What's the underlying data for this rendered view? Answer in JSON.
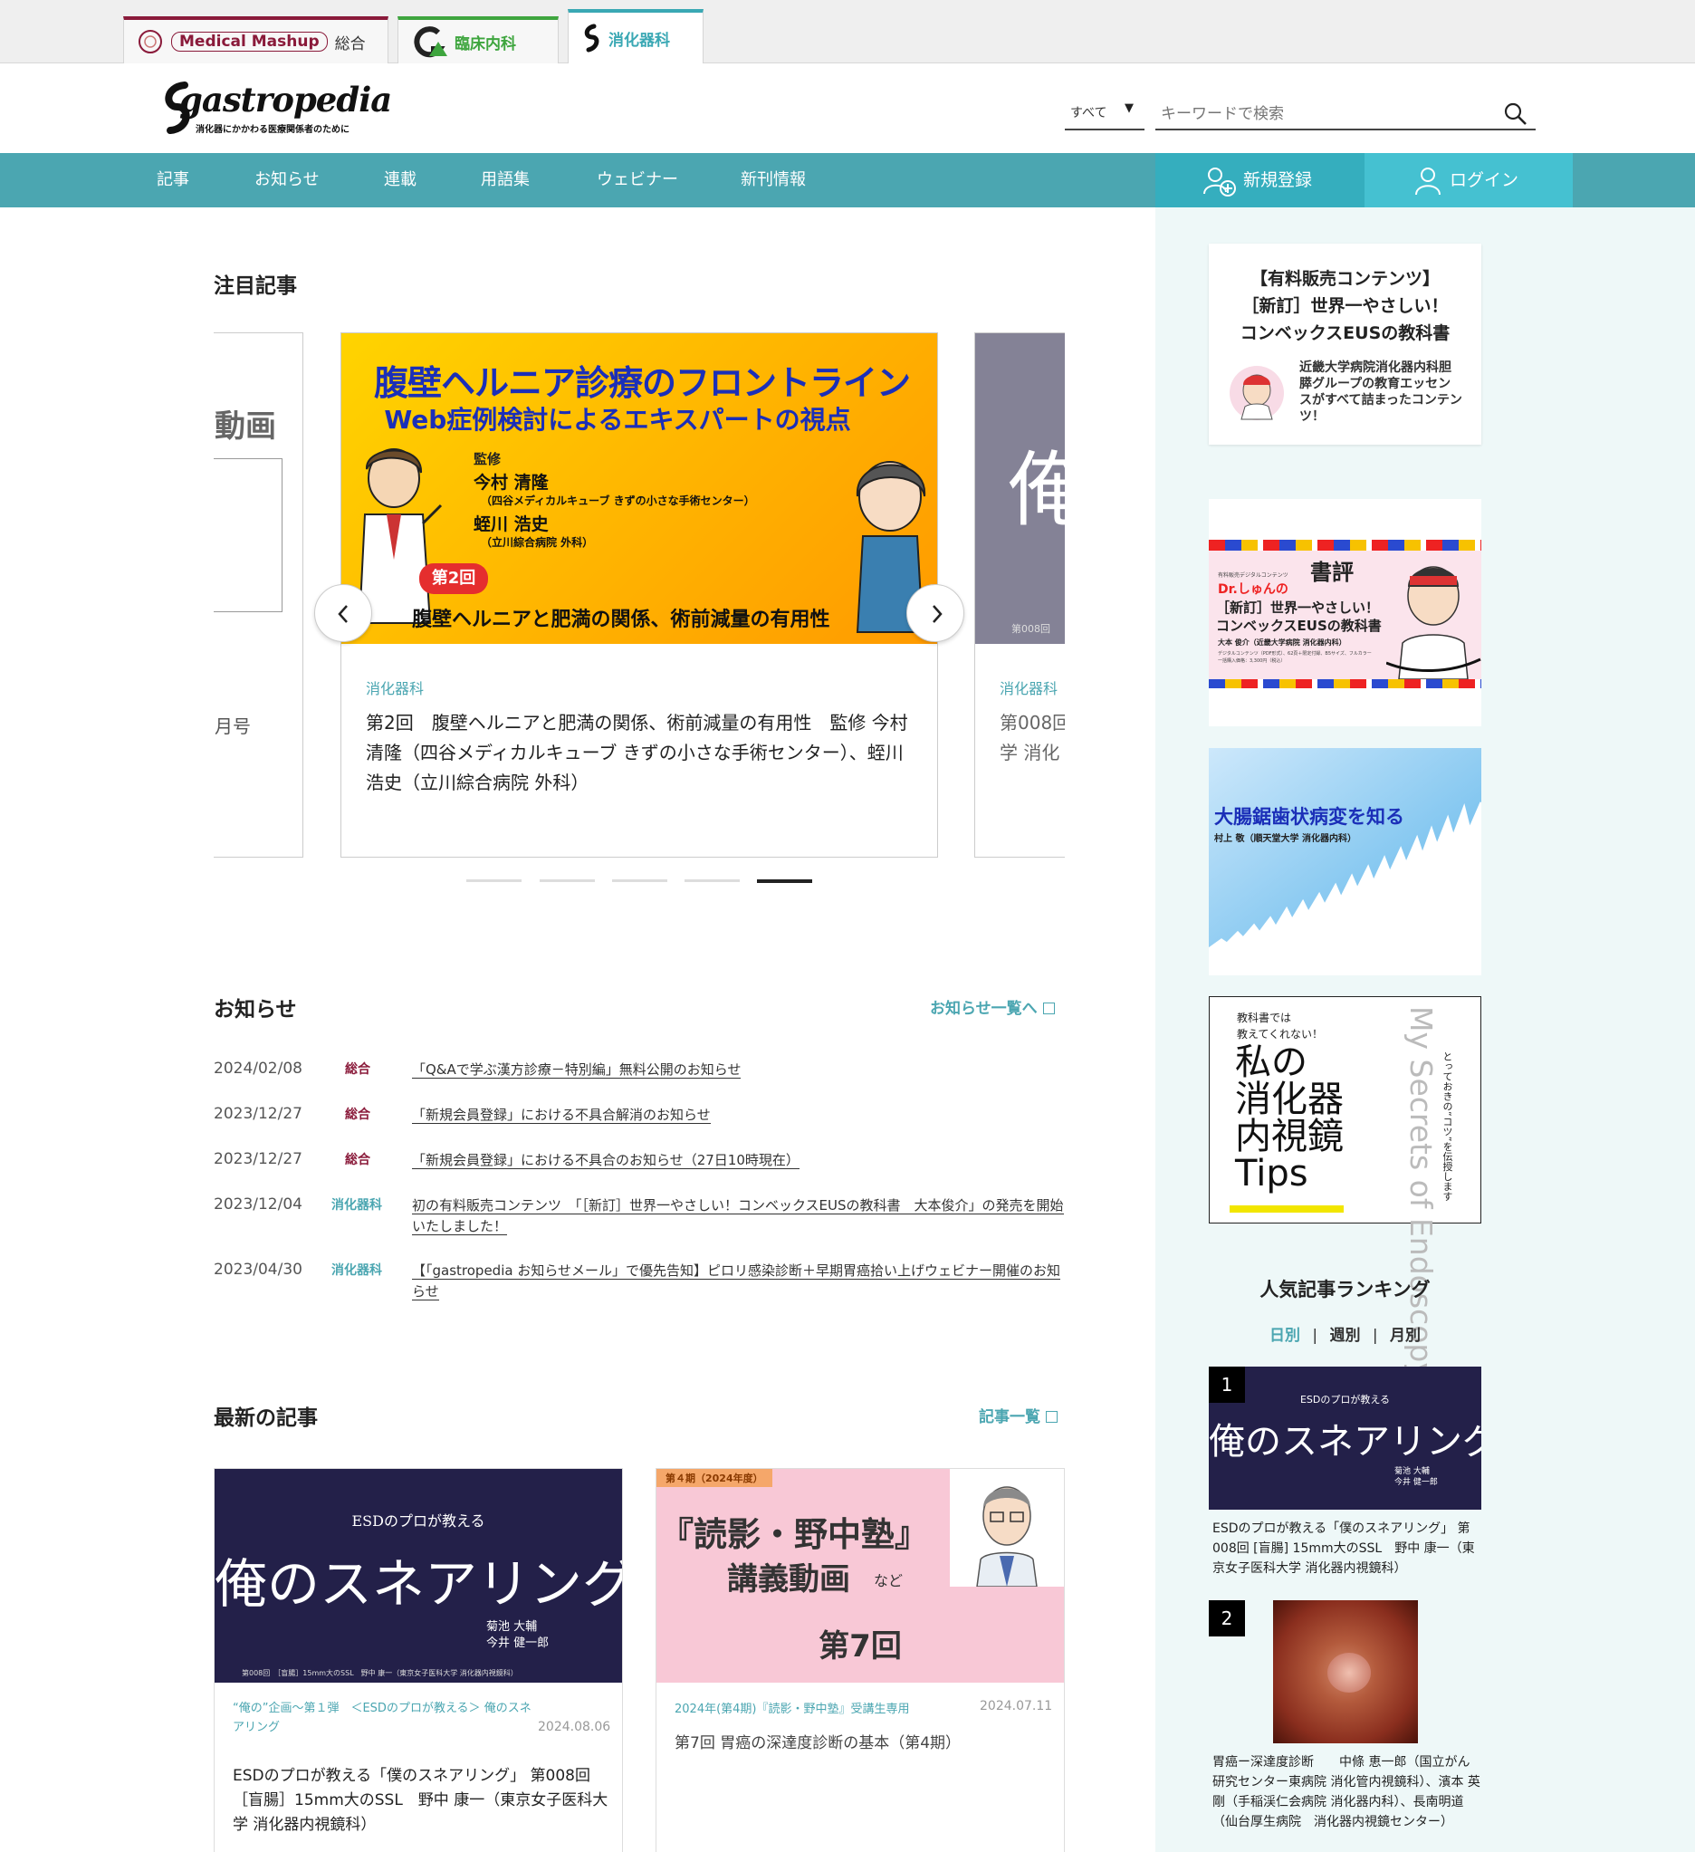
{
  "site_tabs": [
    {
      "name": "Medical Mashup",
      "label": "総合",
      "brand_color": "#8a1a3a"
    },
    {
      "name": "",
      "label": "臨床内科",
      "brand_color": "#3ea53e"
    },
    {
      "name": "",
      "label": "消化器科",
      "brand_color": "#3aa8b4"
    }
  ],
  "header": {
    "logo": "gastropedia",
    "tagline": "消化器にかかわる医療関係者のために",
    "search_scope": "すべて",
    "search_placeholder": "キーワードで検索"
  },
  "nav": {
    "items": [
      "記事",
      "お知らせ",
      "連載",
      "用語集",
      "ウェビナー",
      "新刊情報"
    ],
    "register": "新規登録",
    "login": "ログイン"
  },
  "featured": {
    "title": "注目記事",
    "left_peek": {
      "text": "動画",
      "date": "月号"
    },
    "main": {
      "banner_title": "腹壁ヘルニア診療のフロントライン",
      "banner_subtitle": "Web症例検討によるエキスパートの視点",
      "supervision_label": "監修",
      "person1": "今村 清隆",
      "person1_affil": "（四谷メディカルキューブ きずの小さな手術センター）",
      "person2": "蛭川 浩史",
      "person2_affil": "（立川綜合病院 外科）",
      "episode_badge": "第2回",
      "episode_title": "腹壁ヘルニアと肥満の関係、術前減量の有用性",
      "category": "消化器科",
      "text": "第2回　腹壁ヘルニアと肥満の関係、術前減量の有用性　監修 今村清隆（四谷メディカルキューブ きずの小さな手術センター）、蛭川浩史（立川綜合病院 外科）"
    },
    "right_peek": {
      "glyph": "俺",
      "episode": "第008回",
      "category": "消化器科",
      "line1": "第008回",
      "line2": "学 消化"
    },
    "slide_count": 5,
    "active_slide": 5
  },
  "news": {
    "title": "お知らせ",
    "more": "お知らせ一覧へ",
    "items": [
      {
        "date": "2024/02/08",
        "category": "総合",
        "text": "「Q&Aで学ぶ漢方診療－特別編」無料公開のお知らせ"
      },
      {
        "date": "2023/12/27",
        "category": "総合",
        "text": "「新規会員登録」における不具合解消のお知らせ"
      },
      {
        "date": "2023/12/27",
        "category": "総合",
        "text": "「新規会員登録」における不具合のお知らせ（27日10時現在）"
      },
      {
        "date": "2023/12/04",
        "category": "消化器科",
        "text": "初の有料販売コンテンツ　「［新訂］世界一やさしい！コンベックスEUSの教科書　大本俊介」の発売を開始いたしました！"
      },
      {
        "date": "2023/04/30",
        "category": "消化器科",
        "text": "【「gastropedia お知らせメール」で優先告知】ピロリ感染診断＋早期胃癌拾い上げウェビナー開催のお知らせ"
      }
    ]
  },
  "latest": {
    "title": "最新の記事",
    "more": "記事一覧",
    "articles": [
      {
        "image_small": "ESDのプロが教える",
        "image_title": "俺のスネアリング",
        "image_authors": "菊池 大輔\n今井 健一郎",
        "image_footer": "第008回　［盲腸］15mm大のSSL　野中 康一（東京女子医科大学 消化器内視鏡科）",
        "series": "“俺の”企画〜第１弾　＜ESDのプロが教える＞ 俺のスネアリング",
        "date": "2024.08.06",
        "title": "ESDのプロが教える「僕のスネアリング」 第008回［盲腸］15mm大のSSL　野中 康一（東京女子医科大学 消化器内視鏡科）"
      },
      {
        "image_tag": "第４期（2024年度）",
        "image_title": "『読影・野中塾』",
        "image_sub": "講義動画",
        "image_nado": "など",
        "image_episode": "第7回",
        "series": "2024年(第4期)『読影・野中塾』受講生専用",
        "date": "2024.07.11",
        "title": "第7回 胃癌の深達度診断の基本（第4期）"
      }
    ]
  },
  "sidebar": {
    "promo": {
      "line1": "【有料販売コンテンツ】",
      "line2": "［新訂］世界一やさしい！",
      "line3": "コンベックスEUSの教科書",
      "desc": "近畿大学病院消化器内科胆膵グループの教育エッセンスがすべて詰まったコンテンツ！"
    },
    "banner_review": {
      "badge": "書評",
      "small": "有料販売デジタルコンテンツ",
      "brand": "Dr.しゅんの",
      "title1": "［新訂］世界一やさしい！",
      "title2": "コンベックスEUSの教科書",
      "author": "大本 俊介（近畿大学病院 消化器内科）",
      "note1": "デジタルコンテンツ（PDF形式）、62頁＋限定付録、B5サイズ、フルカラー",
      "note2": "一括購入価格：3,300円（税込）"
    },
    "banner_serrated": {
      "title": "大腸鋸歯状病変を知る",
      "author": "村上 敬（順天堂大学 消化器内科）"
    },
    "banner_tips": {
      "small1": "教科書では",
      "small2": "教えてくれない！",
      "title": "私の\n消化器\n内視鏡\nTips",
      "en": "My Secrets of Endoscopy",
      "vertical": "とっておきの“コツ”を伝授します"
    },
    "ranking": {
      "title": "人気記事ランキング",
      "tabs": [
        "日別",
        "週別",
        "月別"
      ],
      "active_tab": "日別",
      "items": [
        {
          "rank": "1",
          "image_small": "ESDのプロが教える",
          "image_title": "俺のスネアリング",
          "image_authors": "菊池 大輔\n今井 健一郎",
          "text": "ESDのプロが教える「僕のスネアリング」 第008回 [盲腸] 15mm大のSSL　野中 康一（東京女子医科大学 消化器内視鏡科）"
        },
        {
          "rank": "2",
          "text": "胃癌ー深達度診断　　中條 恵一郎（国立がん研究センター東病院 消化管内視鏡科）、濱本 英剛（手稲渓仁会病院 消化器内科）、長南明道（仙台厚生病院　消化器内視鏡センター）"
        }
      ]
    }
  },
  "colors": {
    "teal": "#4ba6b1",
    "teal_dark": "#35aebe",
    "teal_light": "#45c1d1",
    "sidebar_bg": "#eef8f8",
    "total_red": "#8a1a3a",
    "navy": "#232049",
    "pink": "#f8c8d6",
    "yellow": "#ffc400"
  }
}
